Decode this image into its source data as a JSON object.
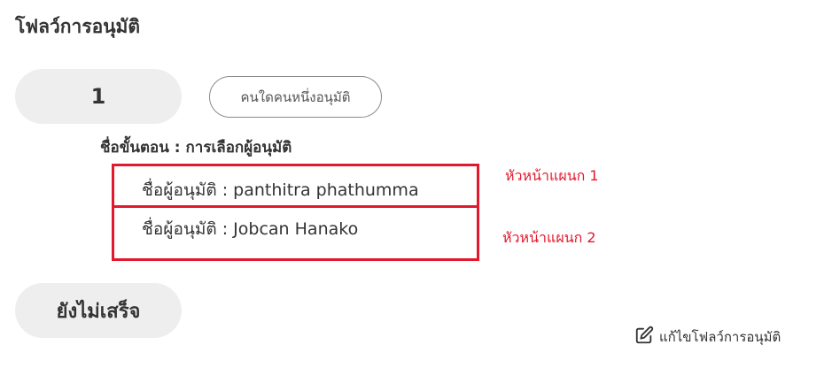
{
  "page_title": "โฟลว์การอนุมัติ",
  "step": {
    "number": "1",
    "condition": "คนใดคนหนึ่งอนุมัติ",
    "name": "ชื่อขั้นตอน : การเลือกผู้อนุมัติ"
  },
  "approvers": [
    {
      "label": "ชื่อผู้อนุมัติ : panthitra phathumma",
      "note": "หัวหน้าแผนก 1"
    },
    {
      "label": "ชื่อผู้อนุมัติ : Jobcan Hanako",
      "note": "หัวหน้าแผนก 2"
    }
  ],
  "status": "ยังไม่เสร็จ",
  "edit_link": {
    "icon": "edit-icon",
    "label": "แก้ไขโฟลว์การอนุมัติ"
  },
  "colors": {
    "highlight": "#e3182d",
    "pill_bg": "#eeeeee",
    "text": "#333333"
  }
}
